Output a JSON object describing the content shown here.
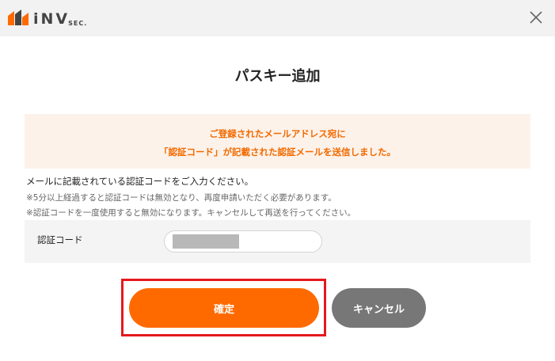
{
  "header": {
    "logo_text": "iNV",
    "logo_sub": "SEC.",
    "close_icon": "close-icon"
  },
  "dialog": {
    "title": "パスキー追加",
    "notice_line1": "ご登録されたメールアドレス宛に",
    "notice_line2": "「認証コード」が記載された認証メールを送信しました。",
    "instruction": "メールに記載されている認証コードをご入力ください。",
    "note1": "※5分以上経過すると認証コードは無効となり、再度申請いただく必要があります。",
    "note2": "※認証コードを一度使用すると無効になります。キャンセルして再送を行ってください。",
    "code_label": "認証コード",
    "code_value": "",
    "confirm_label": "確定",
    "cancel_label": "キャンセル"
  },
  "colors": {
    "accent": "#ff6a00",
    "notice_text": "#f26a00",
    "notice_bg": "#fdf2ea",
    "cancel_bg": "#777777",
    "highlight": "#e5191e"
  }
}
